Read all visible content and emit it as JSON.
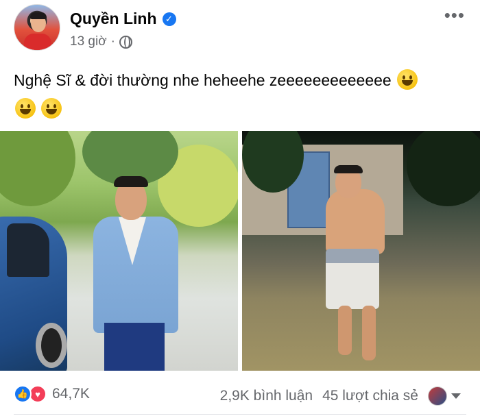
{
  "post": {
    "author": "Quyền Linh",
    "verified_icon": "verified-badge-icon",
    "timestamp": "13 giờ",
    "separator": "·",
    "audience_icon": "globe-icon",
    "more_icon": "more-options-icon",
    "caption": "Nghệ Sĩ & đời thường nhe heheehe zeeeeeeeeeeeee"
  },
  "stats": {
    "reactions_count": "64,7K",
    "comments": "2,9K bình luận",
    "shares": "45 lượt chia sẻ"
  },
  "colors": {
    "accent": "#1877f2",
    "love": "#f33e58",
    "muted": "#65676b"
  }
}
